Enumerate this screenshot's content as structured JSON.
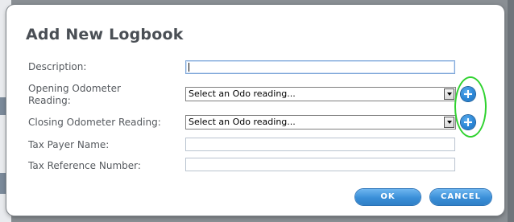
{
  "dialog": {
    "title": "Add New Logbook",
    "fields": {
      "description": {
        "label": "Description:",
        "value": ""
      },
      "opening_odometer": {
        "label_line1": "Opening Odometer",
        "label_line2": "Reading:",
        "selected": "Select an Odo reading..."
      },
      "closing_odometer": {
        "label": "Closing Odometer Reading:",
        "selected": "Select an Odo reading..."
      },
      "tax_payer_name": {
        "label": "Tax Payer Name:",
        "value": ""
      },
      "tax_reference_number": {
        "label": "Tax Reference Number:",
        "value": ""
      }
    },
    "buttons": {
      "ok_label": "OK",
      "cancel_label": "CANCEL"
    },
    "icons": {
      "add_opening": "plus-circle-icon",
      "add_closing": "plus-circle-icon"
    },
    "colors": {
      "button_blue": "#3a8fd8",
      "highlight_green": "#2fd22f",
      "title_gray": "#4a4f55"
    }
  }
}
